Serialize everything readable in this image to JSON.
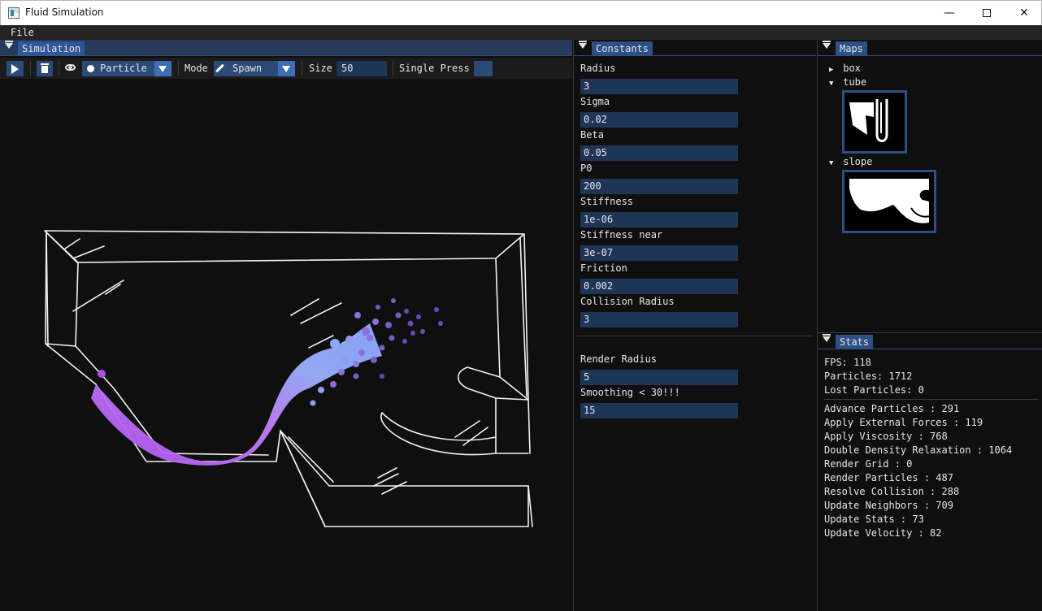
{
  "window": {
    "title": "Fluid Simulation",
    "min_glyph": "—",
    "close_glyph": "✕"
  },
  "menu": {
    "file": "File"
  },
  "simulation": {
    "tab": "Simulation",
    "toolbar": {
      "brush": "Particle",
      "mode_label": "Mode",
      "mode": "Spawn",
      "size_label": "Size",
      "size": "50",
      "single_press": "Single Press"
    }
  },
  "constants": {
    "tab": "Constants",
    "fields": [
      {
        "label": "Radius",
        "value": "3"
      },
      {
        "label": "Sigma",
        "value": "0.02"
      },
      {
        "label": "Beta",
        "value": "0.05"
      },
      {
        "label": "P0",
        "value": "200"
      },
      {
        "label": "Stiffness",
        "value": "1e-06"
      },
      {
        "label": "Stiffness near",
        "value": "3e-07"
      },
      {
        "label": "Friction",
        "value": "0.002"
      },
      {
        "label": "Collision Radius",
        "value": "3"
      }
    ],
    "render": [
      {
        "label": "Render Radius",
        "value": "5"
      },
      {
        "label": "Smoothing < 30!!!",
        "value": "15"
      }
    ]
  },
  "maps": {
    "tab": "Maps",
    "items": [
      {
        "name": "box",
        "expanded": false
      },
      {
        "name": "tube",
        "expanded": true
      },
      {
        "name": "slope",
        "expanded": true
      }
    ]
  },
  "stats": {
    "tab": "Stats",
    "fps": "FPS: 118",
    "particles": "Particles: 1712",
    "lost": "Lost Particles: 0",
    "timings": [
      "Advance Particles : 291",
      "Apply External Forces : 119",
      "Apply Viscosity : 768",
      "Double Density Relaxation : 1064",
      "Render Grid : 0",
      "Render Particles : 487",
      "Resolve Collision : 288",
      "Update Neighbors : 709",
      "Update Stats : 73",
      "Update Velocity : 82"
    ]
  },
  "colors": {
    "accent": "#2d4f83",
    "input_bg": "#1f3557",
    "fluid_start": "#b050f0",
    "fluid_end": "#8fb0ff"
  }
}
